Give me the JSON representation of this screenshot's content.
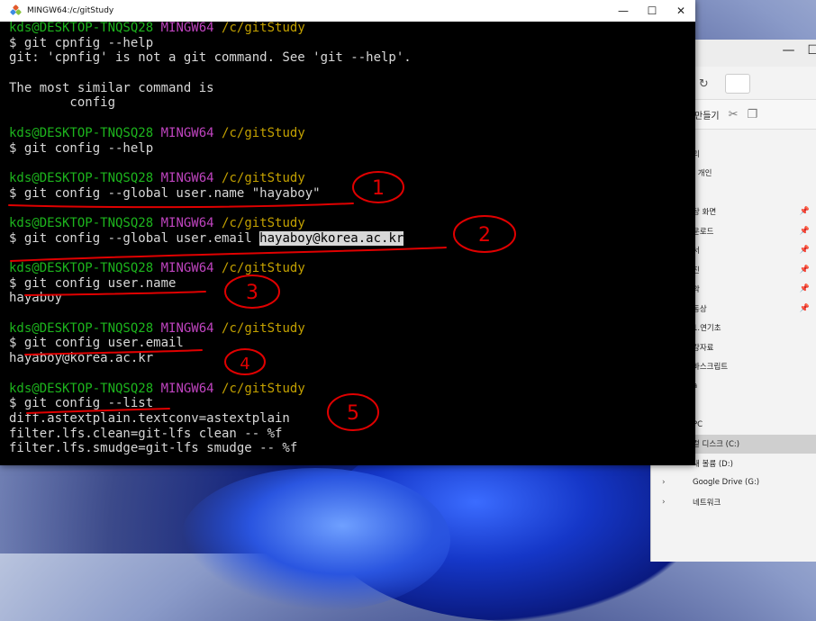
{
  "window": {
    "title": "MINGW64:/c/gitStudy",
    "controls": {
      "minimize": "—",
      "maximize": "☐",
      "close": "✕"
    }
  },
  "terminal": {
    "lines": [
      {
        "kind": "prompt",
        "user": "kds@DESKTOP-TNQSQ28",
        "shell": "MINGW64",
        "path": "/c/gitStudy"
      },
      {
        "kind": "cmd",
        "text": "$ git cpnfig --help"
      },
      {
        "kind": "out",
        "text": "git: 'cpnfig' is not a git command. See 'git --help'."
      },
      {
        "kind": "blank",
        "text": ""
      },
      {
        "kind": "out",
        "text": "The most similar command is"
      },
      {
        "kind": "out",
        "text": "        config"
      },
      {
        "kind": "blank",
        "text": ""
      },
      {
        "kind": "prompt",
        "user": "kds@DESKTOP-TNQSQ28",
        "shell": "MINGW64",
        "path": "/c/gitStudy"
      },
      {
        "kind": "cmd",
        "text": "$ git config --help"
      },
      {
        "kind": "blank",
        "text": ""
      },
      {
        "kind": "prompt",
        "user": "kds@DESKTOP-TNQSQ28",
        "shell": "MINGW64",
        "path": "/c/gitStudy"
      },
      {
        "kind": "cmd",
        "text": "$ git config --global user.name \"hayaboy\""
      },
      {
        "kind": "blank",
        "text": ""
      },
      {
        "kind": "prompt",
        "user": "kds@DESKTOP-TNQSQ28",
        "shell": "MINGW64",
        "path": "/c/gitStudy"
      },
      {
        "kind": "cmd-hl",
        "text": "$ git config --global user.email ",
        "hl": "hayaboy@korea.ac.kr"
      },
      {
        "kind": "blank",
        "text": ""
      },
      {
        "kind": "prompt",
        "user": "kds@DESKTOP-TNQSQ28",
        "shell": "MINGW64",
        "path": "/c/gitStudy"
      },
      {
        "kind": "cmd",
        "text": "$ git config user.name"
      },
      {
        "kind": "out",
        "text": "hayaboy"
      },
      {
        "kind": "blank",
        "text": ""
      },
      {
        "kind": "prompt",
        "user": "kds@DESKTOP-TNQSQ28",
        "shell": "MINGW64",
        "path": "/c/gitStudy"
      },
      {
        "kind": "cmd",
        "text": "$ git config user.email"
      },
      {
        "kind": "out",
        "text": "hayaboy@korea.ac.kr"
      },
      {
        "kind": "blank",
        "text": ""
      },
      {
        "kind": "prompt",
        "user": "kds@DESKTOP-TNQSQ28",
        "shell": "MINGW64",
        "path": "/c/gitStudy"
      },
      {
        "kind": "cmd",
        "text": "$ git config --list"
      },
      {
        "kind": "out",
        "text": "diff.astextplain.textconv=astextplain"
      },
      {
        "kind": "out",
        "text": "filter.lfs.clean=git-lfs clean -- %f"
      },
      {
        "kind": "out",
        "text": "filter.lfs.smudge=git-lfs smudge -- %f"
      }
    ]
  },
  "annotations": {
    "numbers": [
      "1",
      "2",
      "3",
      "4",
      "5"
    ],
    "color": "#e00000"
  },
  "explorer": {
    "nav_icons": [
      "arrow-up-icon",
      "refresh-icon"
    ],
    "toolbar": {
      "new_label": "만들기",
      "icons": [
        "cut-icon",
        "copy-icon"
      ]
    },
    "items": [
      {
        "label": "리",
        "pinned": false
      },
      {
        "label": "- 개인",
        "pinned": false
      },
      {
        "label": "",
        "pinned": false
      },
      {
        "label": "탕 화면",
        "pinned": true
      },
      {
        "label": "운로드",
        "pinned": true
      },
      {
        "label": "서",
        "pinned": true
      },
      {
        "label": "진",
        "pinned": true
      },
      {
        "label": "악",
        "pinned": true
      },
      {
        "label": "동상",
        "pinned": true
      },
      {
        "label": "1.연기초",
        "pinned": false
      },
      {
        "label": "강자료",
        "pinned": false
      },
      {
        "label": "바스크립트",
        "pinned": false
      },
      {
        "label": "a",
        "pinned": false
      },
      {
        "label": "",
        "pinned": false
      },
      {
        "label": "PC",
        "pinned": false
      },
      {
        "label": "컬 디스크 (C:)",
        "pinned": false,
        "selected": true
      },
      {
        "label": "새 볼륨 (D:)",
        "pinned": false,
        "chevron": true
      },
      {
        "label": "Google Drive (G:)",
        "pinned": false,
        "chevron": true
      },
      {
        "label": "네트워크",
        "pinned": false,
        "chevron": true
      }
    ]
  }
}
